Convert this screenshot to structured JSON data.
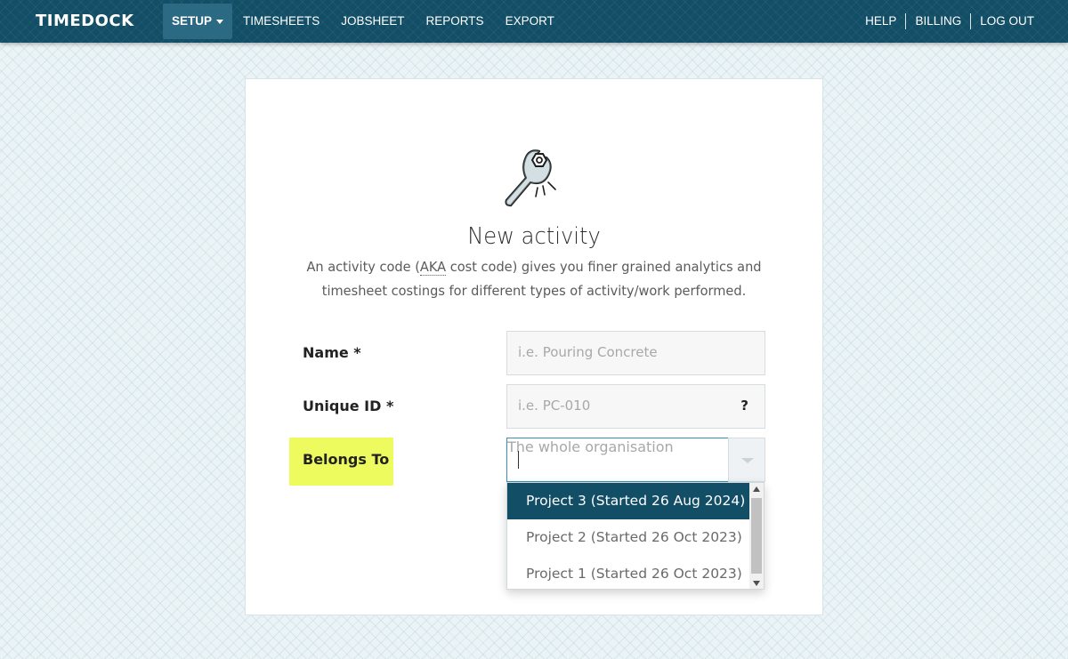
{
  "navbar": {
    "brand": "TIMEDOCK",
    "items": [
      {
        "label": "SETUP"
      },
      {
        "label": "TIMESHEETS"
      },
      {
        "label": "JOBSHEET"
      },
      {
        "label": "REPORTS"
      },
      {
        "label": "EXPORT"
      }
    ],
    "right_items": [
      {
        "label": "HELP"
      },
      {
        "label": "BILLING"
      },
      {
        "label": "LOG OUT"
      }
    ],
    "color": "#124e66"
  },
  "form": {
    "icon": "wrench-icon",
    "title": "New activity",
    "description_part1": "An activity code (",
    "description_abbr": "AKA",
    "description_part2": " cost code) gives you finer grained analytics and timesheet costings for different types of activity/work performed.",
    "fields": {
      "name": {
        "label": "Name *",
        "placeholder": "i.e. Pouring Concrete",
        "value": ""
      },
      "unique_id": {
        "label": "Unique ID *",
        "placeholder": "i.e. PC-010",
        "value": "",
        "help": "?"
      },
      "belongs_to": {
        "label": "Belongs To",
        "placeholder": "The whole organisation",
        "value": "",
        "highlight_color": "#eefb5e"
      }
    }
  },
  "dropdown": {
    "options": [
      {
        "label": "Project 3 (Started 26 Aug 2024)",
        "selected": true
      },
      {
        "label": "Project 2 (Started 26 Oct 2023)",
        "selected": false
      },
      {
        "label": "Project 1 (Started 26 Oct 2023)",
        "selected": false
      }
    ]
  }
}
